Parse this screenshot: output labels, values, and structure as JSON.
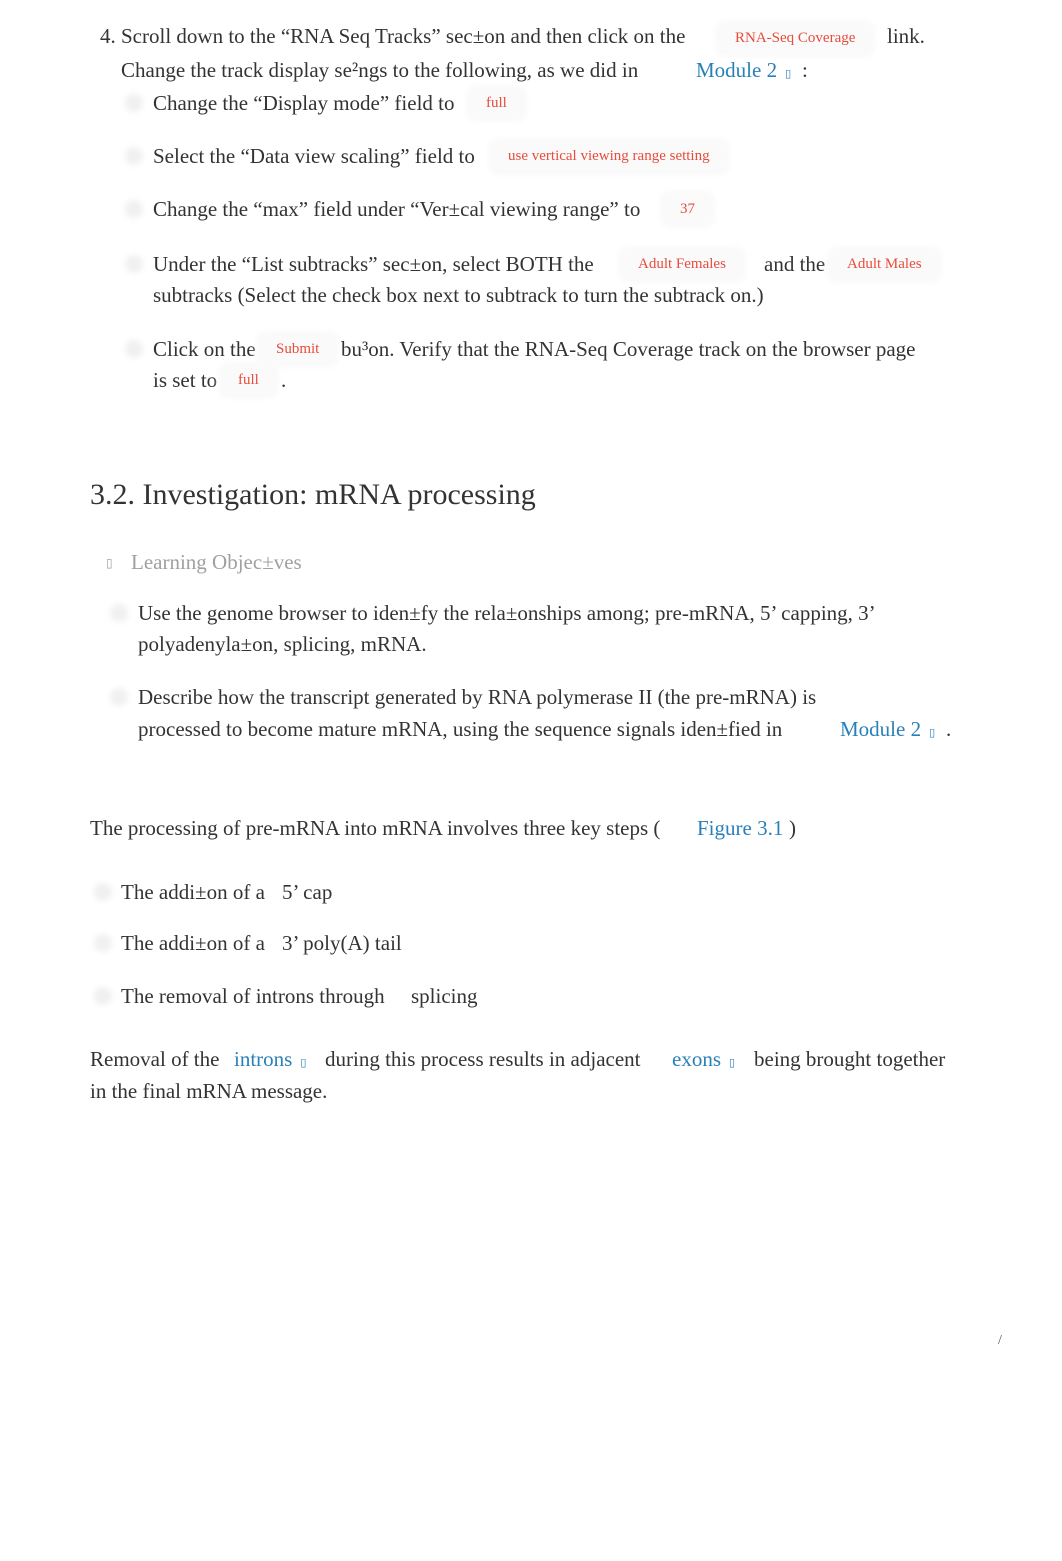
{
  "step4": {
    "number": "4.",
    "line1_text": "Scroll down to the “RNA Seq Tracks” sec±on and then click on the",
    "line1_code": "RNA-Seq Coverage",
    "line1_end": "link.",
    "line2_text": "Change the track display se²ngs to the following, as we did in",
    "line2_link": "Module 2",
    "line2_end": ":",
    "substeps": [
      {
        "text": "Change the “Display mode” field to",
        "code": "full"
      },
      {
        "text": "Select the “Data view scaling” field to",
        "code": "use vertical viewing range setting"
      },
      {
        "text": "Change the “max” field under “Ver±cal viewing range” to",
        "code": "37"
      },
      {
        "text": "Under the “List subtracks” sec±on, select BOTH the",
        "code": "Adult Females",
        "mid": "and the",
        "code2": "Adult Males",
        "line2": "subtracks (Select the check box next to subtrack to turn the subtrack on.)"
      },
      {
        "text": "Click on the",
        "code": "Submit",
        "mid": "bu³on. Verify that the RNA-Seq Coverage track on the browser page",
        "line2": "is set to",
        "code2": "full",
        "end": "."
      }
    ]
  },
  "section": {
    "heading": "3.2. Investigation: mRNA processing",
    "learning_objectives_label": "Learning Objec±ves",
    "objectives": [
      {
        "line1": "Use the genome browser to iden±fy the rela±onships among; pre-mRNA, 5’ capping, 3’",
        "line2": "polyadenyla±on, splicing, mRNA."
      },
      {
        "line1": "Describe how the transcript generated by RNA polymerase II (the pre-mRNA) is",
        "line2": "processed to become mature mRNA, using the sequence signals iden±fied in",
        "link": "Module 2",
        "end": "."
      }
    ],
    "intro_text": "The processing of pre-mRNA into mRNA involves three key steps (",
    "intro_link": "Figure 3.1",
    "intro_end": ")",
    "steps": [
      {
        "text": "The addi±on of a",
        "term": "5’ cap"
      },
      {
        "text": "The addi±on of a",
        "term": "3’ poly(A) tail"
      },
      {
        "text": "The removal of introns through",
        "term": "splicing"
      }
    ],
    "para_start": "Removal of the",
    "para_link1": "introns",
    "para_mid": "during this process results in adjacent",
    "para_link2": "exons",
    "para_end": "being brought together",
    "para_line2": "in the final mRNA message."
  },
  "page_marker": "/",
  "colors": {
    "text": "#333333",
    "code": "#e74c3c",
    "link": "#2980b9",
    "muted": "#a0a0a0"
  }
}
